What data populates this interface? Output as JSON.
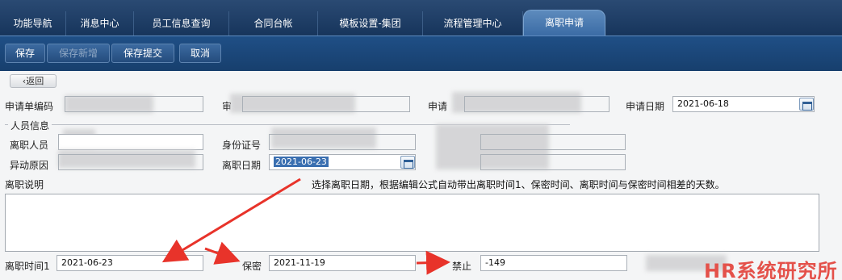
{
  "tabs": [
    {
      "label": "功能导航"
    },
    {
      "label": "消息中心"
    },
    {
      "label": "员工信息查询"
    },
    {
      "label": "合同台帐"
    },
    {
      "label": "模板设置-集团"
    },
    {
      "label": "流程管理中心"
    },
    {
      "label": "离职申请",
      "active": true
    }
  ],
  "toolbar": {
    "save": "保存",
    "save_new": "保存新增",
    "save_submit": "保存提交",
    "cancel": "取消"
  },
  "back_label": "返回",
  "form": {
    "apply_no_label": "申请单编码",
    "applicant_partial_label": "审",
    "applicant_label": "申请",
    "apply_date_label": "申请日期",
    "apply_date_value": "2021-06-18",
    "section_title": "人员信息",
    "leaver_label": "离职人员",
    "id_label": "身份证号",
    "change_reason_label": "异动原因",
    "leave_date_label": "离职日期",
    "leave_date_value": "2021-06-23",
    "leave_desc_label": "离职说明",
    "note": "选择离职日期，根据编辑公式自动带出离职时间1、保密时间、离职时间与保密时间相差的天数。",
    "leave_time1_label": "离职时间1",
    "leave_time1_value": "2021-06-23",
    "secret_label": "保密",
    "secret_value": "2021-11-19",
    "ban_label": "禁止",
    "ban_value": "-149"
  },
  "watermark": "HR系统研究所",
  "colors": {
    "accent": "#3b6ca5",
    "arrow": "#e8332a",
    "watermark": "#e4514a"
  }
}
